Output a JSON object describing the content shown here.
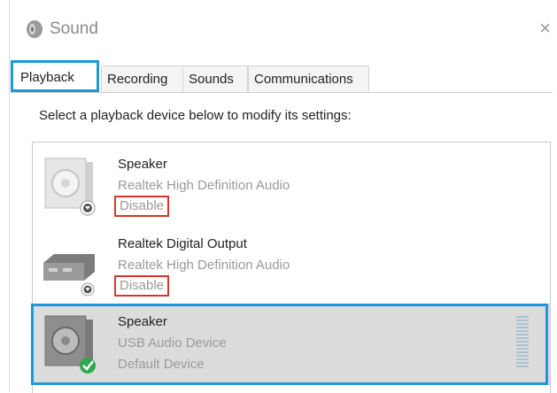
{
  "window": {
    "title": "Sound",
    "close_glyph": "×",
    "title_icon": "speaker-icon"
  },
  "tabs": [
    {
      "label": "Playback",
      "active": true
    },
    {
      "label": "Recording",
      "active": false
    },
    {
      "label": "Sounds",
      "active": false
    },
    {
      "label": "Communications",
      "active": false
    }
  ],
  "instruction": "Select a playback device below to modify its settings:",
  "devices": [
    {
      "name": "Speaker",
      "driver": "Realtek High Definition Audio",
      "status": "Disable",
      "icon": "speaker-device-icon",
      "badge": "down-arrow-badge-icon"
    },
    {
      "name": "Realtek Digital Output",
      "driver": "Realtek High Definition Audio",
      "status": "Disable",
      "icon": "digital-output-device-icon",
      "badge": "down-arrow-badge-icon"
    },
    {
      "name": "Speaker",
      "driver": "USB Audio Device",
      "status": "Default Device",
      "icon": "speaker-device-icon",
      "badge": "green-check-badge-icon",
      "selected": true
    }
  ],
  "colors": {
    "accent": "#1a9ad6",
    "highlight": "#d9342b",
    "selection_bg": "#dcdcdc"
  }
}
